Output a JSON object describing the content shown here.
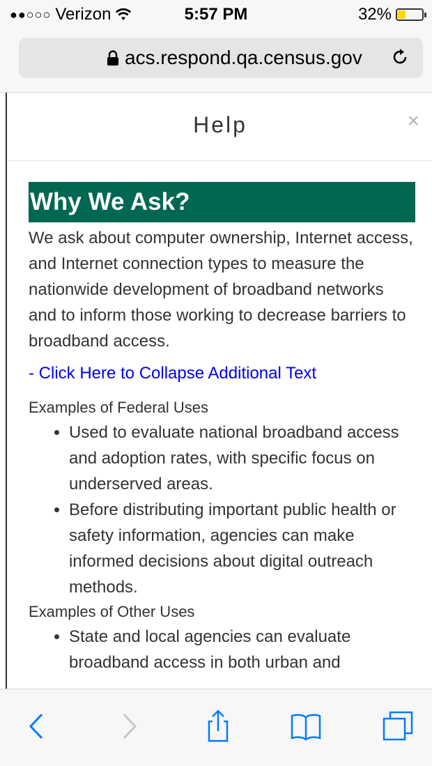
{
  "status_bar": {
    "signal": "●●○○○",
    "carrier": "Verizon",
    "time": "5:57 PM",
    "battery_text": "32%",
    "battery_level": 0.32,
    "battery_color": "#ffd60a"
  },
  "browser": {
    "url": "acs.respond.qa.census.gov",
    "lock_icon": "lock-icon",
    "reload_icon": "reload-icon"
  },
  "modal": {
    "title": "Help",
    "close_label": "×",
    "heading": "Why We Ask?",
    "heading_bg": "#006752",
    "intro": "We ask about computer ownership, Internet access, and Internet connection types to measure the nationwide development of broadband networks and to inform those working to decrease barriers to broadband access.",
    "collapse_link": "- Click Here to Collapse Additional Text",
    "federal_title": "Examples of Federal Uses",
    "federal_items": [
      "Used to evaluate national broadband access and adoption rates, with specific focus on underserved areas.",
      "Before distributing important public health or safety information, agencies can make informed decisions about digital outreach methods."
    ],
    "other_title": "Examples of Other Uses",
    "other_items": [
      "State and local agencies can evaluate broadband access in both urban and"
    ]
  },
  "toolbar": {
    "icons": [
      "back-icon",
      "forward-icon",
      "share-icon",
      "bookmarks-icon",
      "tabs-icon"
    ],
    "accent": "#007aff",
    "disabled": "#c7c7cc"
  }
}
